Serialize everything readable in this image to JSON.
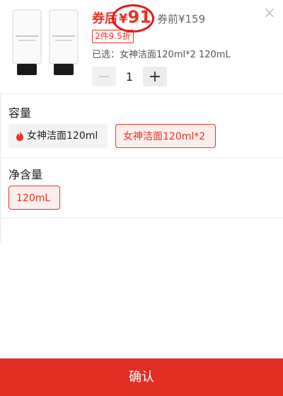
{
  "close": {
    "icon": "close-icon",
    "glyph": "×"
  },
  "product": {
    "coupon_prefix": "券后",
    "price_symbol": "¥",
    "price": "91",
    "original_price": "券前¥159",
    "badge": "2件9.5折",
    "selected_text": "已选：女神洁面120ml*2 120mL"
  },
  "stepper": {
    "minus": "−",
    "value": "1",
    "plus": "+"
  },
  "capacity": {
    "title": "容量",
    "options": [
      {
        "label": "女神洁面120ml",
        "icon": "fire-icon",
        "selected": false
      },
      {
        "label": "女神洁面120ml*2",
        "selected": true
      }
    ]
  },
  "net_content": {
    "title": "净含量",
    "options": [
      {
        "label": "120mL",
        "selected": true
      }
    ]
  },
  "confirm": {
    "label": "确认"
  },
  "colors": {
    "accent": "#e93323",
    "button": "#e02e24",
    "circle": "#e3161b"
  }
}
